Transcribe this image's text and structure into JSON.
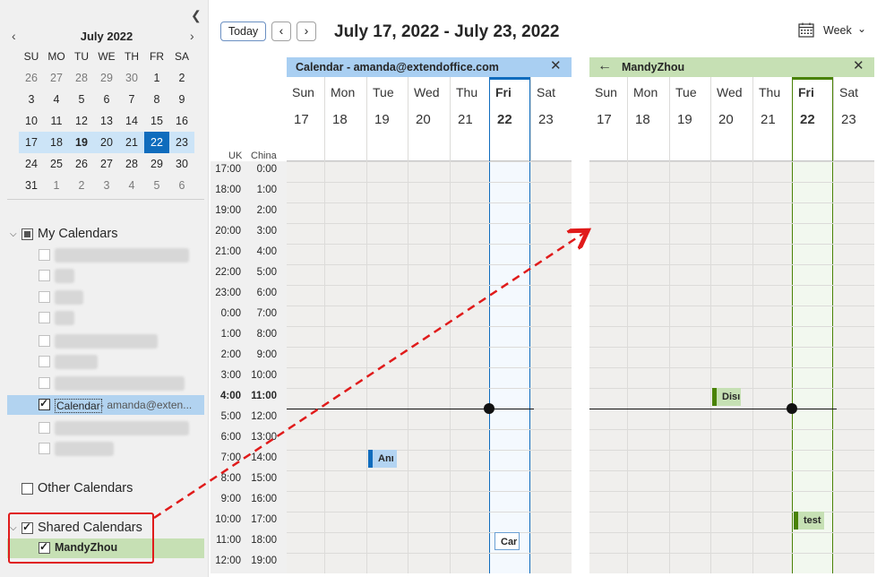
{
  "mini_calendar": {
    "title": "July 2022",
    "prev_icon": "chevron-left-icon",
    "next_icon": "chevron-right-icon",
    "weekdays": [
      "SU",
      "MO",
      "TU",
      "WE",
      "TH",
      "FR",
      "SA"
    ],
    "weeks": [
      [
        "26",
        "27",
        "28",
        "29",
        "30",
        "1",
        "2"
      ],
      [
        "3",
        "4",
        "5",
        "6",
        "7",
        "8",
        "9"
      ],
      [
        "10",
        "11",
        "12",
        "13",
        "14",
        "15",
        "16"
      ],
      [
        "17",
        "18",
        "19",
        "20",
        "21",
        "22",
        "23"
      ],
      [
        "24",
        "25",
        "26",
        "27",
        "28",
        "29",
        "30"
      ],
      [
        "31",
        "1",
        "2",
        "3",
        "4",
        "5",
        "6"
      ]
    ]
  },
  "sidebar": {
    "collapse_icon": "chevron-left-icon",
    "my_calendars": "My Calendars",
    "calendar_item_name": "Calendar",
    "calendar_item_email": " - amanda@exten...",
    "other_calendars": "Other Calendars",
    "shared_calendars": "Shared Calendars",
    "shared_item": "MandyZhou"
  },
  "toolbar": {
    "today": "Today",
    "prev": "‹",
    "next": "›",
    "date_range": "July 17, 2022 - July 23, 2022",
    "view": "Week",
    "view_icon": "calendar-grid-icon"
  },
  "time_labels": {
    "uk_header": "UK",
    "china_header": "China",
    "uk": [
      "17:00",
      "18:00",
      "19:00",
      "20:00",
      "21:00",
      "22:00",
      "23:00",
      "0:00",
      "1:00",
      "2:00",
      "3:00",
      "4:00",
      "5:00",
      "6:00",
      "7:00",
      "8:00",
      "9:00",
      "10:00",
      "11:00",
      "12:00"
    ],
    "china": [
      "0:00",
      "1:00",
      "2:00",
      "3:00",
      "4:00",
      "5:00",
      "6:00",
      "7:00",
      "8:00",
      "9:00",
      "10:00",
      "11:00",
      "12:00",
      "13:00",
      "14:00",
      "15:00",
      "16:00",
      "17:00",
      "18:00",
      "19:00"
    ]
  },
  "panes": [
    {
      "title": "Calendar - amanda@extendoffice.com",
      "days": [
        "Sun",
        "Mon",
        "Tue",
        "Wed",
        "Thu",
        "Fri",
        "Sat"
      ],
      "dates": [
        "17",
        "18",
        "19",
        "20",
        "21",
        "22",
        "23"
      ],
      "events": [
        {
          "label": "Anı",
          "color": "#0f6cbd"
        },
        {
          "label": "Car",
          "color": "#0f6cbd"
        }
      ]
    },
    {
      "title": "MandyZhou",
      "back_icon": "arrow-left-icon",
      "days": [
        "Sun",
        "Mon",
        "Tue",
        "Wed",
        "Thu",
        "Fri",
        "Sat"
      ],
      "dates": [
        "17",
        "18",
        "19",
        "20",
        "21",
        "22",
        "23"
      ],
      "events": [
        {
          "label": "Disı",
          "color": "#498205"
        },
        {
          "label": "test",
          "color": "#498205"
        }
      ]
    }
  ],
  "colors": {
    "pane1_accent": "#0f6cbd",
    "pane1_header": "#a9cff2",
    "pane2_accent": "#498205",
    "pane2_header": "#c6e0b4",
    "annotation_red": "#e01b1b"
  }
}
